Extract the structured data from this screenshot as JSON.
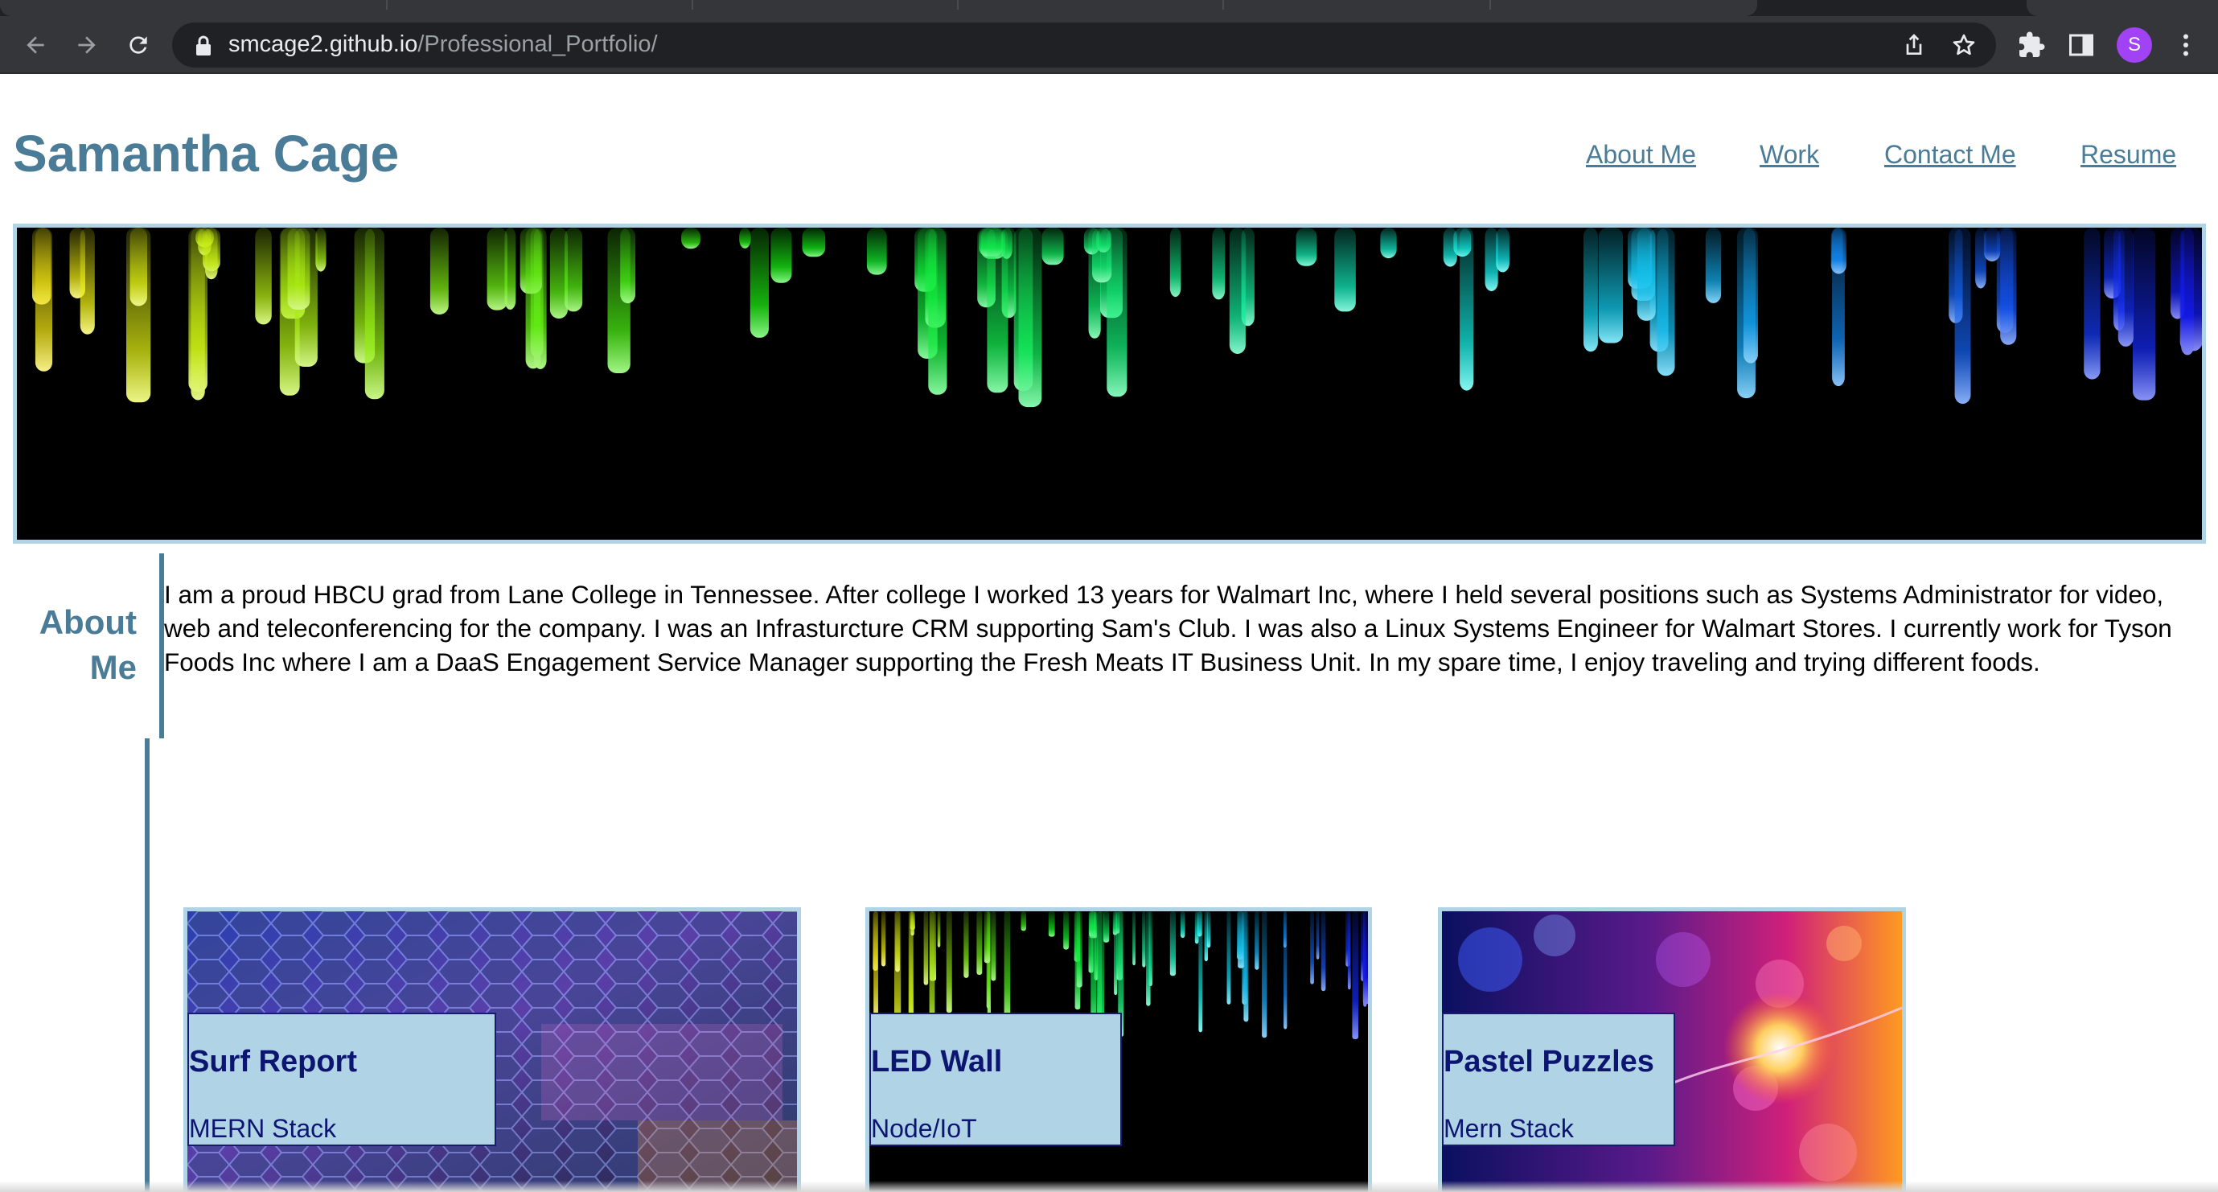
{
  "browser": {
    "url_domain": "smcage2.github.io",
    "url_path": "/Professional_Portfolio/",
    "profile_initial": "S",
    "icons": [
      "back-arrow-icon",
      "forward-arrow-icon",
      "reload-icon",
      "lock-icon",
      "share-icon",
      "bookmark-star-icon",
      "extensions-puzzle-icon",
      "side-panel-icon",
      "kebab-menu-icon"
    ]
  },
  "site": {
    "title": "Samantha Cage",
    "nav": [
      "About Me",
      "Work",
      "Contact Me",
      "Resume"
    ]
  },
  "about": {
    "heading_line1": "About",
    "heading_line2": "Me",
    "text": "I am a proud HBCU grad from Lane College in Tennessee. After college I worked 13 years for Walmart Inc, where I held several positions such as Systems Administrator for video, web and teleconferencing for the company. I was an Infrasturcture CRM supporting Sam's Club. I was also a Linux Systems Engineer for Walmart Stores. I currently work for Tyson Foods Inc where I am a DaaS Engagement Service Manager supporting the Fresh Meats IT Business Unit. In my spare time, I enjoy traveling and trying different foods."
  },
  "projects": [
    {
      "title": "Surf Report",
      "subtitle": "MERN Stack"
    },
    {
      "title": "LED Wall",
      "subtitle": "Node/IoT"
    },
    {
      "title": "Pastel Puzzles",
      "subtitle": "Mern Stack"
    }
  ],
  "colors": {
    "accent": "#4a7b97",
    "border": "#b1d3e6",
    "card_text": "#0c1570",
    "profile": "#a142f4"
  }
}
